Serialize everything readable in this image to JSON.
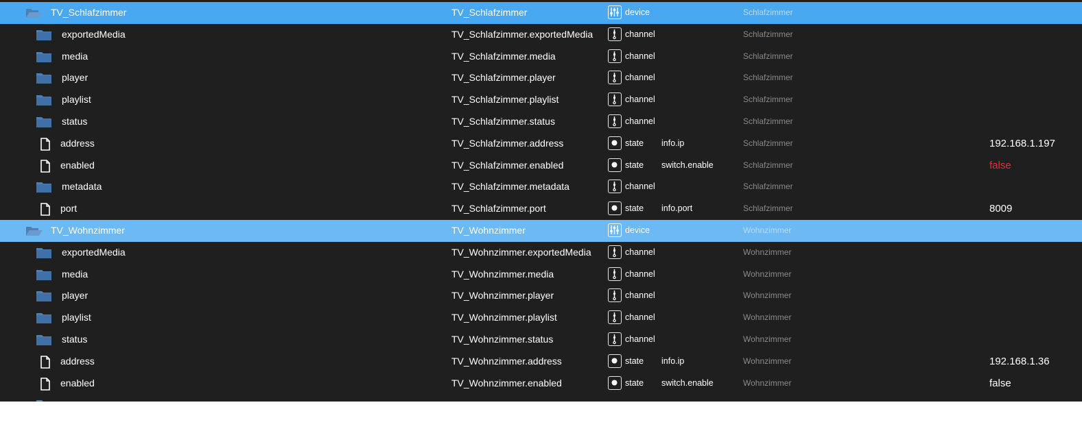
{
  "rows": [
    {
      "level": 0,
      "kind": "folder-open",
      "sel": "sel1",
      "name": "TV_Schlafzimmer",
      "id": "TV_Schlafzimmer",
      "type": "device",
      "role": "",
      "room": "Schlafzimmer",
      "value": "",
      "value_color": ""
    },
    {
      "level": 1,
      "kind": "folder",
      "sel": "",
      "name": "exportedMedia",
      "id": "TV_Schlafzimmer.exportedMedia",
      "type": "channel",
      "role": "",
      "room": "Schlafzimmer",
      "value": "",
      "value_color": ""
    },
    {
      "level": 1,
      "kind": "folder",
      "sel": "",
      "name": "media",
      "id": "TV_Schlafzimmer.media",
      "type": "channel",
      "role": "",
      "room": "Schlafzimmer",
      "value": "",
      "value_color": ""
    },
    {
      "level": 1,
      "kind": "folder",
      "sel": "",
      "name": "player",
      "id": "TV_Schlafzimmer.player",
      "type": "channel",
      "role": "",
      "room": "Schlafzimmer",
      "value": "",
      "value_color": ""
    },
    {
      "level": 1,
      "kind": "folder",
      "sel": "",
      "name": "playlist",
      "id": "TV_Schlafzimmer.playlist",
      "type": "channel",
      "role": "",
      "room": "Schlafzimmer",
      "value": "",
      "value_color": ""
    },
    {
      "level": 1,
      "kind": "folder",
      "sel": "",
      "name": "status",
      "id": "TV_Schlafzimmer.status",
      "type": "channel",
      "role": "",
      "room": "Schlafzimmer",
      "value": "",
      "value_color": ""
    },
    {
      "level": 1,
      "kind": "file",
      "sel": "",
      "name": "address",
      "id": "TV_Schlafzimmer.address",
      "type": "state",
      "role": "info.ip",
      "room": "Schlafzimmer",
      "value": "192.168.1.197",
      "value_color": ""
    },
    {
      "level": 1,
      "kind": "file",
      "sel": "",
      "name": "enabled",
      "id": "TV_Schlafzimmer.enabled",
      "type": "state",
      "role": "switch.enable",
      "room": "Schlafzimmer",
      "value": "false",
      "value_color": "#e0322f"
    },
    {
      "level": 1,
      "kind": "folder",
      "sel": "",
      "name": "metadata",
      "id": "TV_Schlafzimmer.metadata",
      "type": "channel",
      "role": "",
      "room": "Schlafzimmer",
      "value": "",
      "value_color": ""
    },
    {
      "level": 1,
      "kind": "file",
      "sel": "",
      "name": "port",
      "id": "TV_Schlafzimmer.port",
      "type": "state",
      "role": "info.port",
      "room": "Schlafzimmer",
      "value": "8009",
      "value_color": ""
    },
    {
      "level": 0,
      "kind": "folder-open",
      "sel": "sel2",
      "name": "TV_Wohnzimmer",
      "id": "TV_Wohnzimmer",
      "type": "device",
      "role": "",
      "room": "Wohnzimmer",
      "value": "",
      "value_color": ""
    },
    {
      "level": 1,
      "kind": "folder",
      "sel": "",
      "name": "exportedMedia",
      "id": "TV_Wohnzimmer.exportedMedia",
      "type": "channel",
      "role": "",
      "room": "Wohnzimmer",
      "value": "",
      "value_color": ""
    },
    {
      "level": 1,
      "kind": "folder",
      "sel": "",
      "name": "media",
      "id": "TV_Wohnzimmer.media",
      "type": "channel",
      "role": "",
      "room": "Wohnzimmer",
      "value": "",
      "value_color": ""
    },
    {
      "level": 1,
      "kind": "folder",
      "sel": "",
      "name": "player",
      "id": "TV_Wohnzimmer.player",
      "type": "channel",
      "role": "",
      "room": "Wohnzimmer",
      "value": "",
      "value_color": ""
    },
    {
      "level": 1,
      "kind": "folder",
      "sel": "",
      "name": "playlist",
      "id": "TV_Wohnzimmer.playlist",
      "type": "channel",
      "role": "",
      "room": "Wohnzimmer",
      "value": "",
      "value_color": ""
    },
    {
      "level": 1,
      "kind": "folder",
      "sel": "",
      "name": "status",
      "id": "TV_Wohnzimmer.status",
      "type": "channel",
      "role": "",
      "room": "Wohnzimmer",
      "value": "",
      "value_color": ""
    },
    {
      "level": 1,
      "kind": "file",
      "sel": "",
      "name": "address",
      "id": "TV_Wohnzimmer.address",
      "type": "state",
      "role": "info.ip",
      "room": "Wohnzimmer",
      "value": "192.168.1.36",
      "value_color": ""
    },
    {
      "level": 1,
      "kind": "file",
      "sel": "",
      "name": "enabled",
      "id": "TV_Wohnzimmer.enabled",
      "type": "state",
      "role": "switch.enable",
      "room": "Wohnzimmer",
      "value": "false",
      "value_color": ""
    },
    {
      "level": 1,
      "kind": "folder",
      "sel": "",
      "name": "",
      "id": "",
      "type": "",
      "role": "",
      "room": "",
      "value": "",
      "value_color": ""
    }
  ],
  "colors": {
    "background": "#1f1f1f",
    "selected_device_1": "#4aa8f0",
    "selected_device_2": "#6db9f3",
    "folder": "#4d7fb4",
    "room_text": "#8a8a8a",
    "false_value": "#e0322f"
  },
  "icons": {
    "folder-open": "folder-open-icon",
    "folder": "folder-icon",
    "file": "file-icon",
    "device": "device-sliders-icon",
    "channel": "channel-icon",
    "state": "state-dot-icon"
  }
}
